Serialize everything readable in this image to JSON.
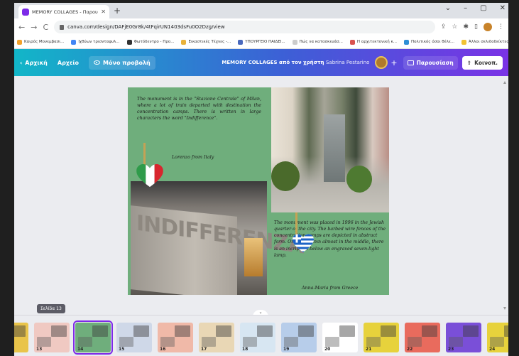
{
  "browser": {
    "tab_title": "MEMORY COLLAGES - Παρουσί",
    "url": "canva.com/design/DAFjE0Gr8k/4tFqirUN1403dsFu0O2Dzg/view",
    "window_controls": [
      "⌄",
      "–",
      "▢",
      "✕"
    ]
  },
  "bookmarks": [
    {
      "label": "Καιρός Μονεμβασι...",
      "color": "#f2a12b"
    },
    {
      "label": "Ιχθύων τρισνταφυλ...",
      "color": "#4285f4"
    },
    {
      "label": "Φωτόδεντρο - Προ...",
      "color": "#333333"
    },
    {
      "label": "Εικαστικές Τέχνες -...",
      "color": "#e9b23a"
    },
    {
      "label": "ΥΠΟΥΡΓΕΙΟ ΠΑΙΔΕΙ...",
      "color": "#4a69bd"
    },
    {
      "label": "Πώς να κατασκευάσ...",
      "color": "#cccccc"
    },
    {
      "label": "Η αρχιτεκτονική κ...",
      "color": "#d9534f"
    },
    {
      "label": "Πολιτικός όσοι θέλε...",
      "color": "#2e8fd6"
    }
  ],
  "bookmarks_other": "Άλλοι σελιδοδείκτες",
  "canva": {
    "home": "Αρχική",
    "file": "Αρχείο",
    "view_only": "Μόνο προβολή",
    "design_title": "MEMORY COLLAGES από τον χρήστη",
    "author": "Sabrina Pestarino",
    "present": "Παρουσίαση",
    "share": "Κοινοπ."
  },
  "slide": {
    "text_top": "The monument is in the \"Stazione Centrale\" of Milan, where a lot of train departed with destination the concentration camps. There is written in large characters the word \"Indifference\".",
    "sign_top": "Lorenzo from Italy",
    "text_bottom": "The monument was placed in 1996 in the Jewish quarter of the city. The barbed wire fences of the concentration camps are depicted in abstract form. On the column almost in the middle, there is an incription below an engraved seven-light lamp.",
    "sign_bottom": "Anna-Maria from Greece",
    "photo_word": "INDIFFERENZA",
    "bg_color": "#6fae7c"
  },
  "filmstrip": {
    "tooltip": "Σελίδα 13",
    "selected_page": 14,
    "pages": [
      {
        "num": "",
        "bg": "#e9c44a"
      },
      {
        "num": "13",
        "bg": "#f0c9c2"
      },
      {
        "num": "14",
        "bg": "#6fae7c"
      },
      {
        "num": "15",
        "bg": "#cfd8e8"
      },
      {
        "num": "16",
        "bg": "#f0b9a8"
      },
      {
        "num": "17",
        "bg": "#e9d7b5"
      },
      {
        "num": "18",
        "bg": "#d7e6f2"
      },
      {
        "num": "19",
        "bg": "#b7cdea"
      },
      {
        "num": "20",
        "bg": "#ffffff"
      },
      {
        "num": "21",
        "bg": "#e7d23c"
      },
      {
        "num": "22",
        "bg": "#e96b5d"
      },
      {
        "num": "23",
        "bg": "#7a4fd8"
      },
      {
        "num": "24",
        "bg": "#e7d23c"
      }
    ]
  }
}
